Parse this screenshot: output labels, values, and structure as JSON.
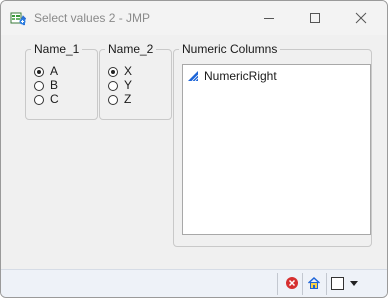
{
  "window": {
    "title": "Select values 2 - JMP"
  },
  "groups": [
    {
      "legend": "Name_1",
      "options": [
        {
          "label": "A",
          "checked": true
        },
        {
          "label": "B",
          "checked": false
        },
        {
          "label": "C",
          "checked": false
        }
      ]
    },
    {
      "legend": "Name_2",
      "options": [
        {
          "label": "X",
          "checked": true
        },
        {
          "label": "Y",
          "checked": false
        },
        {
          "label": "Z",
          "checked": false
        }
      ]
    }
  ],
  "numeric_columns": {
    "legend": "Numeric Columns",
    "items": [
      {
        "label": "NumericRight",
        "icon": "continuous-column-icon"
      }
    ]
  },
  "colors": {
    "accent_blue": "#1c64d8",
    "error_red": "#d63030"
  },
  "statusbar": {
    "icons": [
      "stop-icon",
      "home-icon",
      "window-list-icon"
    ]
  }
}
